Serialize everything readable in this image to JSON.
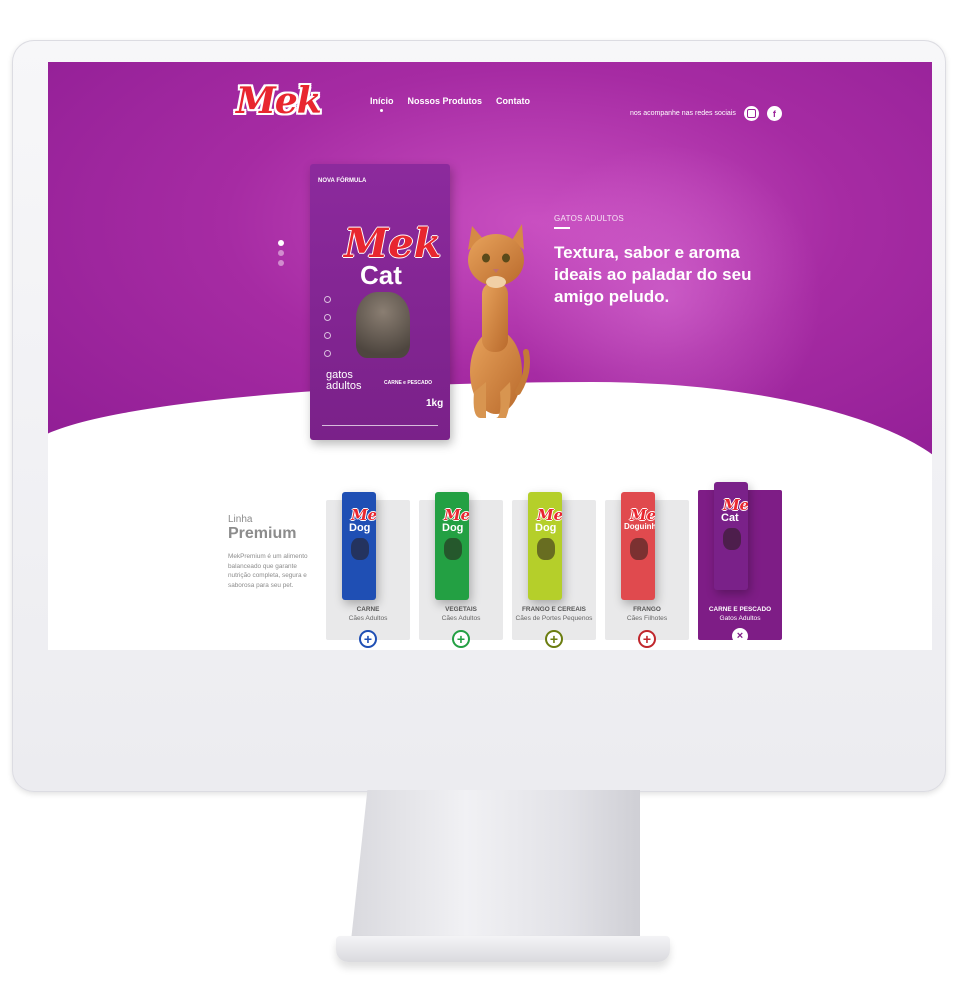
{
  "brand": {
    "logo_text": "Mek",
    "accent": "#a62ba3",
    "logo_color": "#e8262f"
  },
  "nav": {
    "items": [
      {
        "label": "Início",
        "active": true
      },
      {
        "label": "Nossos Produtos",
        "active": false
      },
      {
        "label": "Contato",
        "active": false
      }
    ]
  },
  "social": {
    "label": "nos acompanhe nas redes sociais",
    "icons": [
      "instagram-icon",
      "facebook-icon"
    ],
    "facebook_glyph": "f"
  },
  "hero": {
    "kicker": "GATOS ADULTOS",
    "headline": "Textura, sabor e aroma ideais ao paladar do seu amigo peludo.",
    "slides_total": 3,
    "slide_active": 1,
    "bag": {
      "brand": "Mek",
      "kind": "Cat",
      "badge": "NOVA FÓRMULA",
      "sub": "gatos adultos",
      "flavor": "CARNE e PESCADO",
      "weight": "1kg"
    }
  },
  "premium": {
    "small": "Linha",
    "big": "Premium",
    "description": "MekPremium é um alimento balanceado que garante nutrição completa, segura e saborosa para seu pet."
  },
  "products": [
    {
      "brand": "Mek",
      "kind": "Dog",
      "title": "CARNE",
      "subtitle": "Cães Adultos",
      "bag_color": "#1f4fb4",
      "btn_color": "#1f4fb4",
      "btn_glyph": "+",
      "selected": false
    },
    {
      "brand": "Mek",
      "kind": "Dog",
      "title": "VEGETAIS",
      "subtitle": "Cães Adultos",
      "bag_color": "#23a043",
      "btn_color": "#23a043",
      "btn_glyph": "+",
      "selected": false
    },
    {
      "brand": "Mek",
      "kind": "Dog",
      "title": "FRANGO E CEREAIS",
      "subtitle": "Cães de Portes Pequenos",
      "bag_color": "#b5cf2a",
      "btn_color": "#6b7d10",
      "btn_glyph": "+",
      "selected": false
    },
    {
      "brand": "Mek",
      "kind": "Doguinho",
      "title": "FRANGO",
      "subtitle": "Cães Filhotes",
      "bag_color": "#e04a4e",
      "btn_color": "#c0262c",
      "btn_glyph": "+",
      "selected": false
    },
    {
      "brand": "Mek",
      "kind": "Cat",
      "title": "CARNE E PESCADO",
      "subtitle": "Gatos Adultos",
      "bag_color": "#7a2189",
      "btn_color": "#7e1d86",
      "btn_glyph": "×",
      "selected": true
    }
  ]
}
